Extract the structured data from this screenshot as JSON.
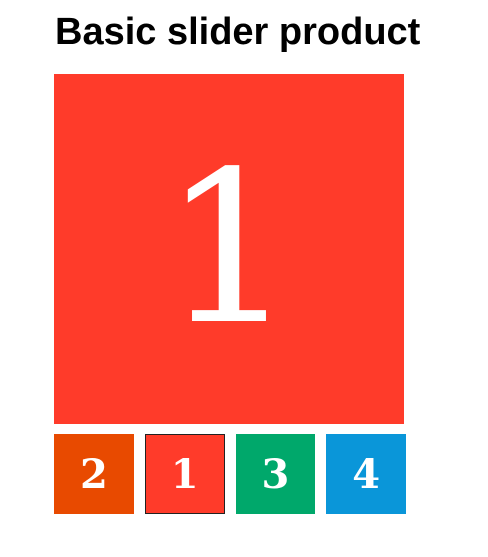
{
  "page": {
    "title": "Basic slider product"
  },
  "slider": {
    "current": {
      "label": "1",
      "color": "#ff3b2a"
    },
    "thumbnails": [
      {
        "label": "2",
        "color": "#e84a00",
        "active": false
      },
      {
        "label": "1",
        "color": "#ff3b2a",
        "active": true
      },
      {
        "label": "3",
        "color": "#00a86b",
        "active": false
      },
      {
        "label": "4",
        "color": "#0a96d9",
        "active": false
      }
    ]
  }
}
